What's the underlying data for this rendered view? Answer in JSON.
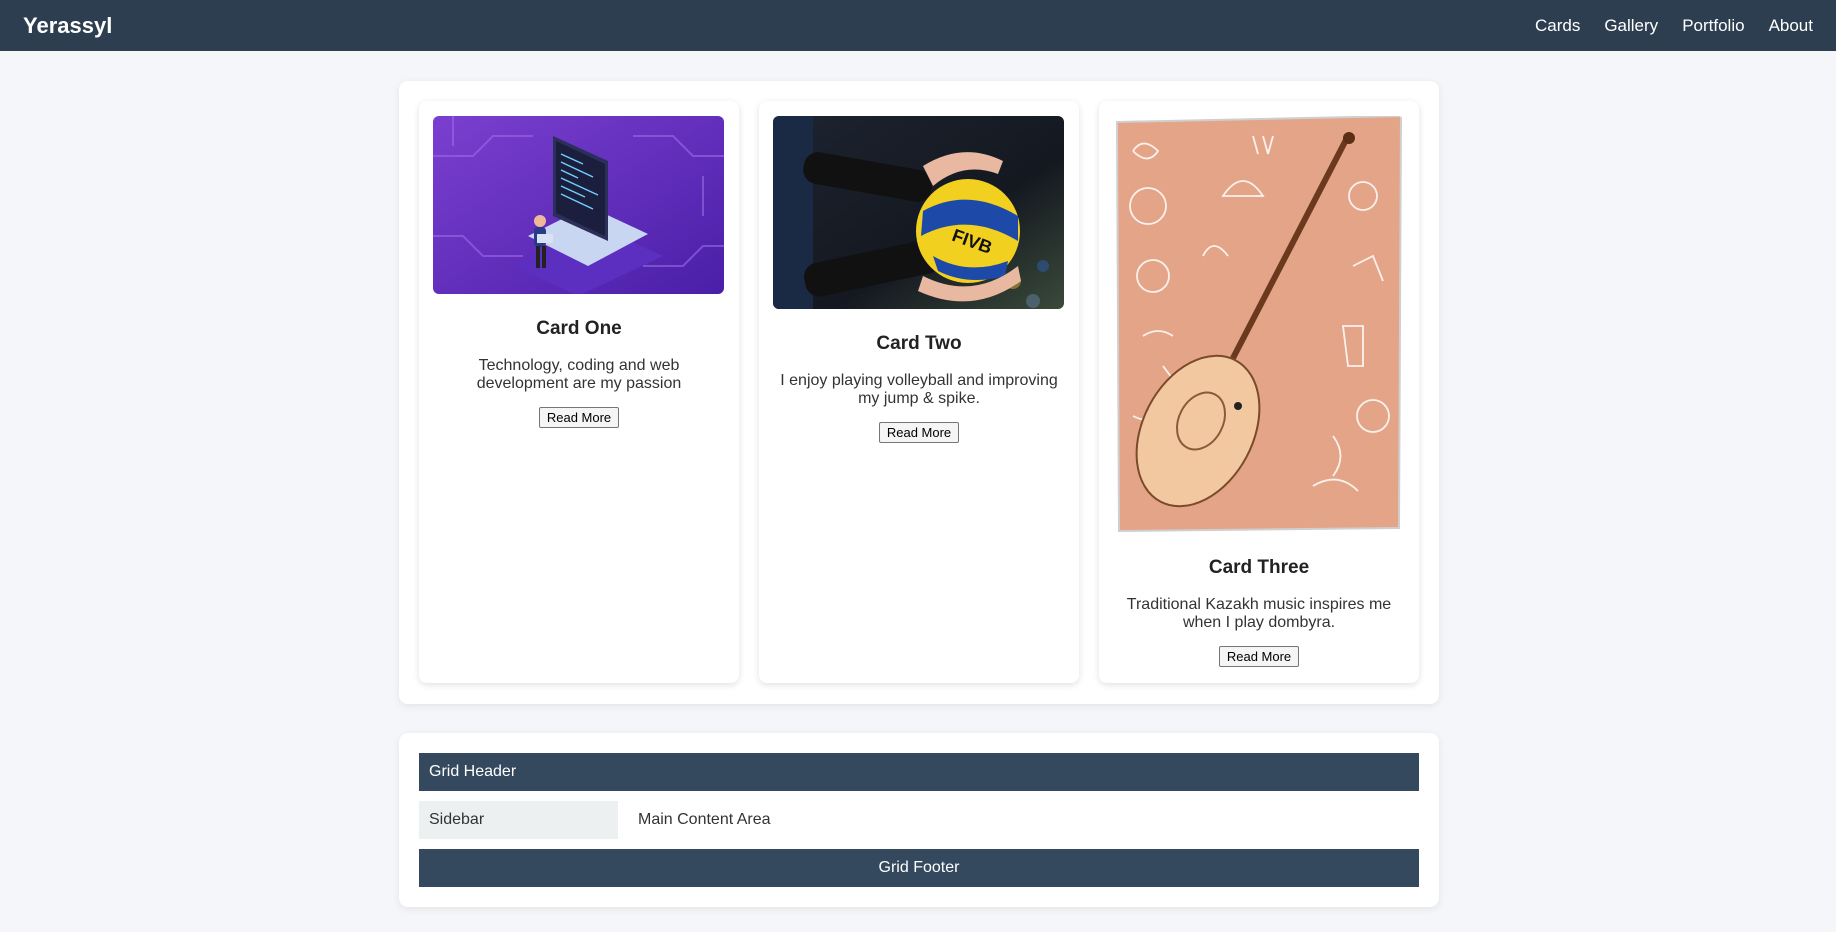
{
  "nav": {
    "brand": "Yerassyl",
    "links": [
      "Cards",
      "Gallery",
      "Portfolio",
      "About"
    ]
  },
  "cards": [
    {
      "title": "Card One",
      "text": "Technology, coding and web development are my passion",
      "button": "Read More",
      "image": "laptop-coding-illustration"
    },
    {
      "title": "Card Two",
      "text": "I enjoy playing volleyball and improving my jump & spike.",
      "button": "Read More",
      "image": "volleyball-photo"
    },
    {
      "title": "Card Three",
      "text": "Traditional Kazakh music inspires me when I play dombyra.",
      "button": "Read More",
      "image": "dombyra-illustration"
    }
  ],
  "grid": {
    "header": "Grid Header",
    "sidebar": "Sidebar",
    "main": "Main Content Area",
    "footer": "Grid Footer"
  },
  "colors": {
    "navbar": "#2c3e50",
    "grid_dark": "#34495e",
    "sidebar_bg": "#ecf0f1",
    "page_bg": "#f4f6f9"
  }
}
